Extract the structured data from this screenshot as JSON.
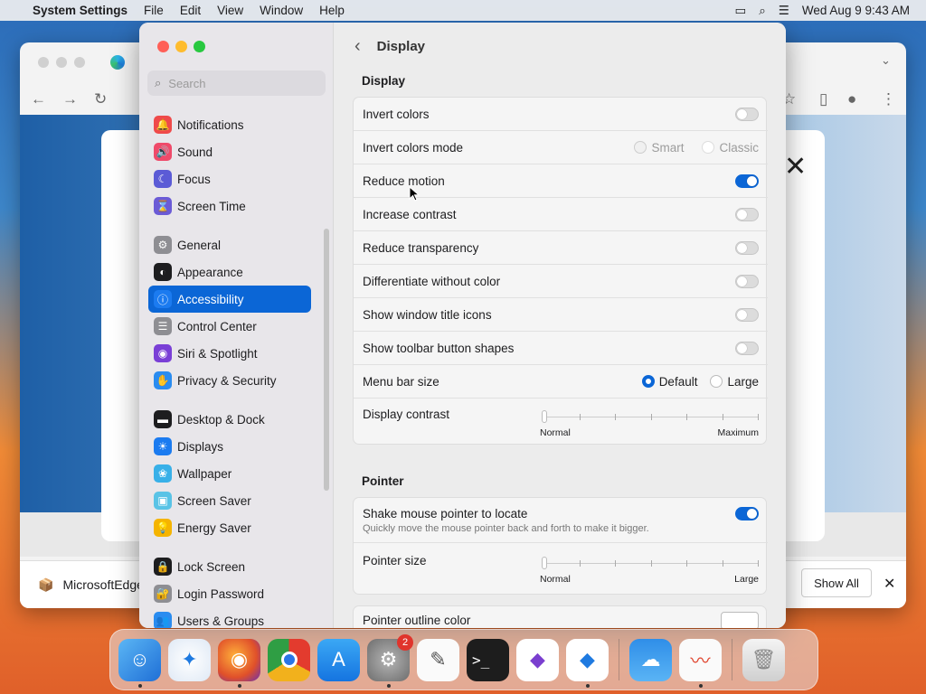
{
  "menubar": {
    "app_name": "System Settings",
    "items": [
      "File",
      "Edit",
      "View",
      "Window",
      "Help"
    ],
    "clock": "Wed Aug 9  9:43 AM"
  },
  "edge": {
    "downloads_file": "MicrosoftEdge",
    "show_all": "Show All"
  },
  "sidebar": {
    "search_placeholder": "Search",
    "items": [
      {
        "label": "Notifications",
        "icon": "bell-icon",
        "color": "#ef4a4a"
      },
      {
        "label": "Sound",
        "icon": "speaker-icon",
        "color": "#ef4a6a"
      },
      {
        "label": "Focus",
        "icon": "moon-icon",
        "color": "#5b5bd6"
      },
      {
        "label": "Screen Time",
        "icon": "hourglass-icon",
        "color": "#6b5bd6"
      },
      {
        "label": "General",
        "icon": "gear-icon",
        "color": "#8e8e93"
      },
      {
        "label": "Appearance",
        "icon": "appearance-icon",
        "color": "#1d1d1f"
      },
      {
        "label": "Accessibility",
        "icon": "accessibility-icon",
        "color": "#1b7bf0"
      },
      {
        "label": "Control Center",
        "icon": "control-center-icon",
        "color": "#8e8e93"
      },
      {
        "label": "Siri & Spotlight",
        "icon": "siri-icon",
        "color": "#7a3fd6"
      },
      {
        "label": "Privacy & Security",
        "icon": "hand-icon",
        "color": "#2a8cf0"
      },
      {
        "label": "Desktop & Dock",
        "icon": "desktop-icon",
        "color": "#1d1d1f"
      },
      {
        "label": "Displays",
        "icon": "sun-icon",
        "color": "#1b7bf0"
      },
      {
        "label": "Wallpaper",
        "icon": "flower-icon",
        "color": "#38b0e8"
      },
      {
        "label": "Screen Saver",
        "icon": "screensaver-icon",
        "color": "#59c3e6"
      },
      {
        "label": "Energy Saver",
        "icon": "bulb-icon",
        "color": "#f5b400"
      },
      {
        "label": "Lock Screen",
        "icon": "lock-icon",
        "color": "#1d1d1f"
      },
      {
        "label": "Login Password",
        "icon": "padlock-icon",
        "color": "#8e8e93"
      },
      {
        "label": "Users & Groups",
        "icon": "users-icon",
        "color": "#2a8cf0"
      }
    ]
  },
  "main": {
    "title": "Display",
    "display_section": "Display",
    "rows": {
      "invert_colors": "Invert colors",
      "invert_mode": "Invert colors mode",
      "invert_mode_opt1": "Smart",
      "invert_mode_opt2": "Classic",
      "reduce_motion": "Reduce motion",
      "increase_contrast": "Increase contrast",
      "reduce_transparency": "Reduce transparency",
      "differentiate": "Differentiate without color",
      "title_icons": "Show window title icons",
      "toolbar_shapes": "Show toolbar button shapes",
      "menu_bar_size": "Menu bar size",
      "menu_bar_opt1": "Default",
      "menu_bar_opt2": "Large",
      "display_contrast": "Display contrast",
      "contrast_lo": "Normal",
      "contrast_hi": "Maximum"
    },
    "toggles": {
      "invert_colors": false,
      "reduce_motion": true,
      "increase_contrast": false,
      "reduce_transparency": false,
      "differentiate": false,
      "title_icons": false,
      "toolbar_shapes": false,
      "shake_pointer": true
    },
    "pointer_section": "Pointer",
    "pointer": {
      "shake": "Shake mouse pointer to locate",
      "shake_desc": "Quickly move the mouse pointer back and forth to make it bigger.",
      "size": "Pointer size",
      "size_lo": "Normal",
      "size_hi": "Large",
      "outline": "Pointer outline color"
    }
  },
  "dock": {
    "settings_badge": "2"
  }
}
